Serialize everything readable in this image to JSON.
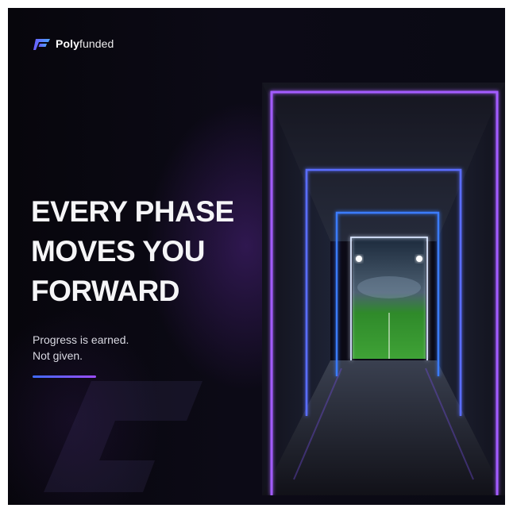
{
  "brand": {
    "name_bold": "Poly",
    "name_light": "funded",
    "logo_gradient": [
      "#6b5bff",
      "#4fa6ff"
    ]
  },
  "headline": {
    "lines": [
      "EVERY PHASE",
      "MOVES YOU",
      "FORWARD"
    ]
  },
  "tagline": {
    "lines": [
      "Progress is earned.",
      "Not given."
    ]
  },
  "colors": {
    "background": "#050409",
    "accent_blue": "#3f6bff",
    "accent_purple": "#9d4dff",
    "neon_outer": "#a35bff",
    "neon_mid": "#3b7bff",
    "pitch_green": "#2f8a2a"
  },
  "icons": [
    "polyfunded-logo-icon"
  ]
}
